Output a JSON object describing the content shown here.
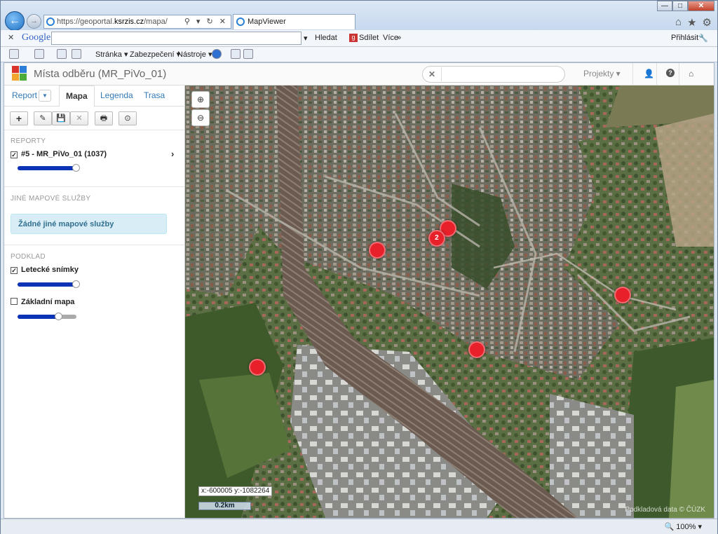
{
  "browser": {
    "url_prefix": "https://geoportal.",
    "url_domain": "ksrzis.cz",
    "url_path": "/mapa/",
    "url_controls": "⚲ ▾ ↻ ✕",
    "tab_title": "MapViewer",
    "window_buttons": {
      "minimize": "—",
      "maximize": "□",
      "close": "✕"
    }
  },
  "google_toolbar": {
    "close": "✕",
    "logo": "Google",
    "search_value": "",
    "search": "Hledat",
    "share": "Sdílet",
    "more": "Více",
    "login": "Přihlásit"
  },
  "command_bar": {
    "page": "Stránka",
    "security": "Zabezpečení",
    "tools": "Nástroje"
  },
  "app": {
    "title": "Místa odběru (MR_PiVo_01)",
    "search_placeholder": "",
    "search_clear": "✕",
    "projects": "Projekty ▾",
    "logo_colors": [
      "#d9342b",
      "#2d7ed8",
      "#f1a52f",
      "#4cab39"
    ]
  },
  "sidebar": {
    "tabs": {
      "report": "Report",
      "report_caret": "▼",
      "map": "Mapa",
      "legend": "Legenda",
      "route": "Trasa"
    },
    "toolbar": [
      "+",
      "✎",
      "💾",
      "✕",
      "🖶",
      "⊙"
    ],
    "reports_heading": "REPORTY",
    "report_item": "#5 - MR_PiVo_01 (1037)",
    "report_opacity": 1.0,
    "other_services_heading": "JINÉ MAPOVÉ SLUŽBY",
    "no_services": "Žádné jiné mapové služby",
    "base_heading": "PODKLAD",
    "base_layers": [
      {
        "label": "Letecké snímky",
        "checked": true,
        "opacity": 1.0
      },
      {
        "label": "Základní mapa",
        "checked": false,
        "opacity": 0.7
      }
    ]
  },
  "map": {
    "zoom_in": "+",
    "zoom_out": "−",
    "coordinates": "x:-600005 y:-1082264",
    "scale": "0.2km",
    "attribution": "Podkladová data © ČÚZK",
    "markers": [
      {
        "label": "",
        "x": 0.363,
        "y": 0.381
      },
      {
        "label": "",
        "x": 0.497,
        "y": 0.33
      },
      {
        "label": "2",
        "x": 0.476,
        "y": 0.354
      },
      {
        "label": "",
        "x": 0.827,
        "y": 0.484
      },
      {
        "label": "",
        "x": 0.552,
        "y": 0.611
      },
      {
        "label": "",
        "x": 0.136,
        "y": 0.651
      }
    ],
    "marker_color": "#e8202a"
  },
  "status_bar": {
    "zoom": "100%"
  }
}
